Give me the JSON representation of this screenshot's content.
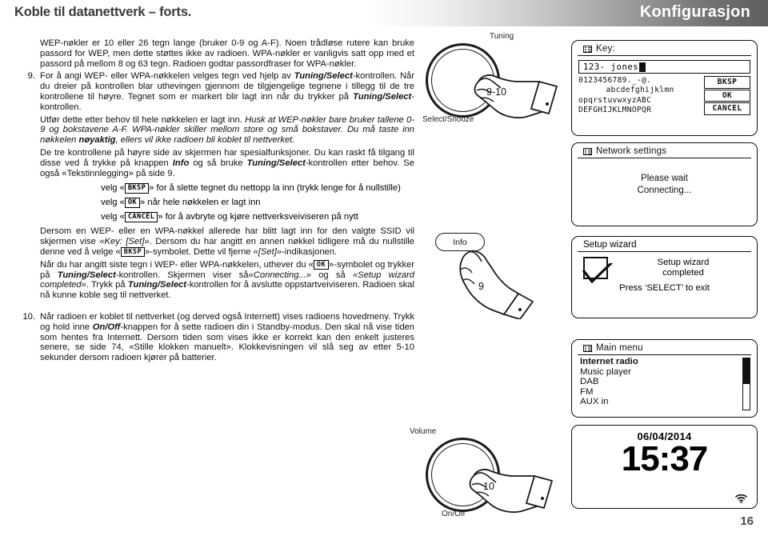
{
  "header": {
    "page_heading": "Koble til datanettverk – forts.",
    "section_title": "Konfigurasjon"
  },
  "page_number": "16",
  "body": {
    "intro_paragraph": "WEP-nøkler er 10 eller 26 tegn lange (bruker 0-9 og A-F). Noen trådløse rutere kan bruke passord for WEP, men dette støttes ikke av radioen. WPA-nøkler er vanligvis satt opp med et passord på mellom 8 og 63 tegn. Radioen godtar passordfraser for WPA-nøkler.",
    "item9": {
      "number": "9.",
      "p1_a": "For å angi WEP- eller WPA-nøkkelen velges tegn ved hjelp av ",
      "p1_b1": "Tuning/Select",
      "p1_b": "-kontrollen. Når du dreier på kontrollen blar uthevingen gjennom de tilgjengelige tegnene i tillegg til de tre kontrollene til høyre. Tegnet som er markert blir lagt inn når du trykker på ",
      "p1_b2": "Tuning/Select",
      "p1_c": "-kontrollen.",
      "p2_a": "Utfør dette etter behov til hele nøkkelen er lagt inn. ",
      "p2_i": "Husk at WEP-nøkler bare bruker tallene 0-9 og bokstavene A-F. WPA-nøkler skiller mellom store og små bokstaver. Du må taste inn nøkkelen ",
      "p2_bi": "nøyaktig",
      "p2_i2": ", ellers vil ikke radioen bli koblet til nettverket.",
      "p3_a": "De tre kontrollene på høyre side av skjermen har spesialfunksjoner. Du kan raskt få tilgang til disse ved å trykke på knappen ",
      "p3_b": "Info",
      "p3_c": " og så bruke ",
      "p3_b2": "Tuning/Select",
      "p3_d": "-kontrollen etter behov. Se også «Tekstinnlegging» på side 9.",
      "bullets": [
        {
          "pre": "velg «",
          "cap": "BKSP",
          "post": "» for å slette tegnet du nettopp la inn (trykk lenge for å nullstille)"
        },
        {
          "pre": "velg «",
          "cap": "OK",
          "post": "» når hele nøkkelen er lagt inn"
        },
        {
          "pre": "velg «",
          "cap": "CANCEL",
          "post": "» for å avbryte og kjøre nettverksveiviseren på nytt"
        }
      ],
      "p4_a": "Dersom en WEP- eller en WPA-nøkkel allerede har blitt lagt inn for den valgte SSID vil skjermen vise ",
      "p4_i1": "«Key: [Set]»",
      "p4_b": ". Dersom du har angitt en annen nøkkel tidligere må du nullstille denne ved å velge «",
      "p4_cap": "BKSP",
      "p4_c": "»-symbolet. Dette vil fjerne ",
      "p4_i2": "«[Set]»",
      "p4_d": "-indikasjonen.",
      "p5_a": "Når du har angitt siste tegn i WEP- eller WPA-nøkkelen, uthever du «",
      "p5_cap": "OK",
      "p5_b": "»-symbolet og trykker på ",
      "p5_b1": "Tuning/Select",
      "p5_c": "-kontrollen. Skjermen viser så",
      "p5_i1": "«Connecting...»",
      "p5_d": " og så ",
      "p5_i2": "«Setup wizard completed»",
      "p5_e": ". Trykk på ",
      "p5_b2": "Tuning/Select",
      "p5_f": "-kontrollen for å avslutte oppstartveiviseren. Radioen skal nå kunne koble seg til nettverket."
    },
    "item10": {
      "number": "10.",
      "p1_a": "Når radioen er koblet til nettverket (og derved også Internett) vises radioens hovedmeny. Trykk og hold inne ",
      "p1_b": "On/Off",
      "p1_c": "-knappen for å sette radioen din i Standby-modus. Den skal nå vise tiden som hentes fra Internett. Dersom tiden som vises ikke er korrekt kan den enkelt justeres senere, se side 74, «Stille klokken manuelt». Klokkevisningen vil slå seg av etter 5-10 sekunder dersom radioen kjører på batterier."
    }
  },
  "illustrations": {
    "tuning_knob": {
      "top_label": "Tuning",
      "bottom_label": "Select/Snooze",
      "step": "9-10"
    },
    "info_button": {
      "label": "Info",
      "step": "9"
    },
    "volume_knob": {
      "top_label": "Volume",
      "bottom_label": "On/Off",
      "step": "10"
    }
  },
  "lcd": {
    "key_screen": {
      "title": "Key:",
      "input_value": "123- jones",
      "char_rows": [
        "0123456789._-@.",
        "abcdefghijklmn",
        "opqrstuvwxyzABC",
        "DEFGHIJKLMNOPQR"
      ],
      "actions": [
        "BKSP",
        "OK",
        "CANCEL"
      ]
    },
    "network_screen": {
      "title": "Network settings",
      "line1": "Please wait",
      "line2": "Connecting..."
    },
    "wizard_screen": {
      "title": "Setup wizard",
      "msg_line1": "Setup wizard",
      "msg_line2": "completed",
      "footer": "Press ‘SELECT’ to exit"
    },
    "main_menu_screen": {
      "title": "Main menu",
      "items": [
        "Internet radio",
        "Music player",
        "DAB",
        "FM",
        "AUX in"
      ],
      "selected_index": 0
    },
    "clock_screen": {
      "date": "06/04/2014",
      "time": "15:37",
      "wifi_icon": "wifi-icon"
    }
  }
}
